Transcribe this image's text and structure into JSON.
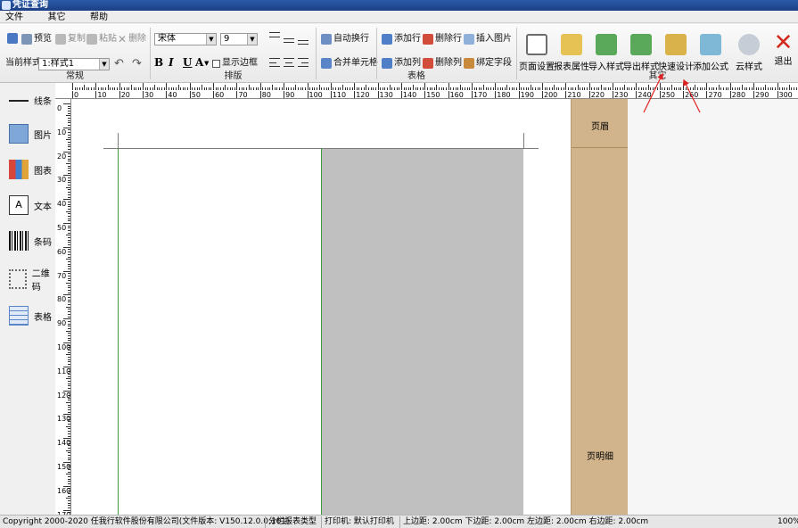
{
  "window": {
    "title": "凭证查询"
  },
  "menu": [
    "文件",
    "其它",
    "帮助"
  ],
  "ribbon": {
    "common": {
      "caption": "常规",
      "preview": "预览",
      "copy": "复制",
      "paste": "粘贴",
      "delete": "删除",
      "current_style_label": "当前样式",
      "current_style_value": "1:样式1"
    },
    "format": {
      "caption": "排版",
      "font": "宋体",
      "size": "9",
      "show_border": "显示边框",
      "bold": "B",
      "italic": "I",
      "underline": "U",
      "font_color": "A"
    },
    "table": {
      "caption": "表格",
      "auto_wrap": "自动换行",
      "merge_cells": "合并单元格",
      "add_row": "添加行",
      "delete_row": "删除行",
      "insert_image": "插入图片",
      "add_col": "添加列",
      "delete_col": "删除列",
      "bind_field": "绑定字段"
    },
    "other": {
      "caption": "其它",
      "page_setup": "页面设置",
      "report_props": "报表属性",
      "import_style": "导入样式",
      "export_style": "导出样式",
      "quick_design": "快速设计",
      "add_formula": "添加公式",
      "cloud_style": "云样式",
      "exit": "退出"
    }
  },
  "ruler": {
    "h_labels": [
      "0",
      "10",
      "20",
      "30",
      "40",
      "50",
      "60",
      "70",
      "80",
      "90",
      "100",
      "110",
      "120",
      "130",
      "140",
      "150",
      "160",
      "170",
      "180",
      "190",
      "200",
      "210",
      "220",
      "230",
      "240",
      "250",
      "260",
      "270",
      "280",
      "290",
      "300"
    ],
    "v_labels": [
      "0",
      "10",
      "20",
      "30",
      "40",
      "50",
      "60",
      "70",
      "80",
      "90",
      "100",
      "110",
      "120",
      "130",
      "140",
      "150",
      "160",
      "170"
    ]
  },
  "toolbox": [
    "线条",
    "图片",
    "图表",
    "文本",
    "条码",
    "二维码",
    "表格"
  ],
  "bands": {
    "header": "页眉",
    "detail": "页明细"
  },
  "status": {
    "copyright": "Copyright 2000-2020 任我行软件股份有限公司(文件版本: V150.12.0.0.101)",
    "report_type": "分栏报表类型",
    "printer": "打印机: 默认打印机",
    "margins": "上边距: 2.00cm 下边距: 2.00cm 左边距: 2.00cm 右边距: 2.00cm",
    "zoom": "100%"
  },
  "colors": {
    "title_bar": "#1b3f86",
    "band": "#d2b48c",
    "gray_area": "#c0c0c0",
    "guide_green": "#3c9a3c",
    "arrow": "#e02020"
  }
}
